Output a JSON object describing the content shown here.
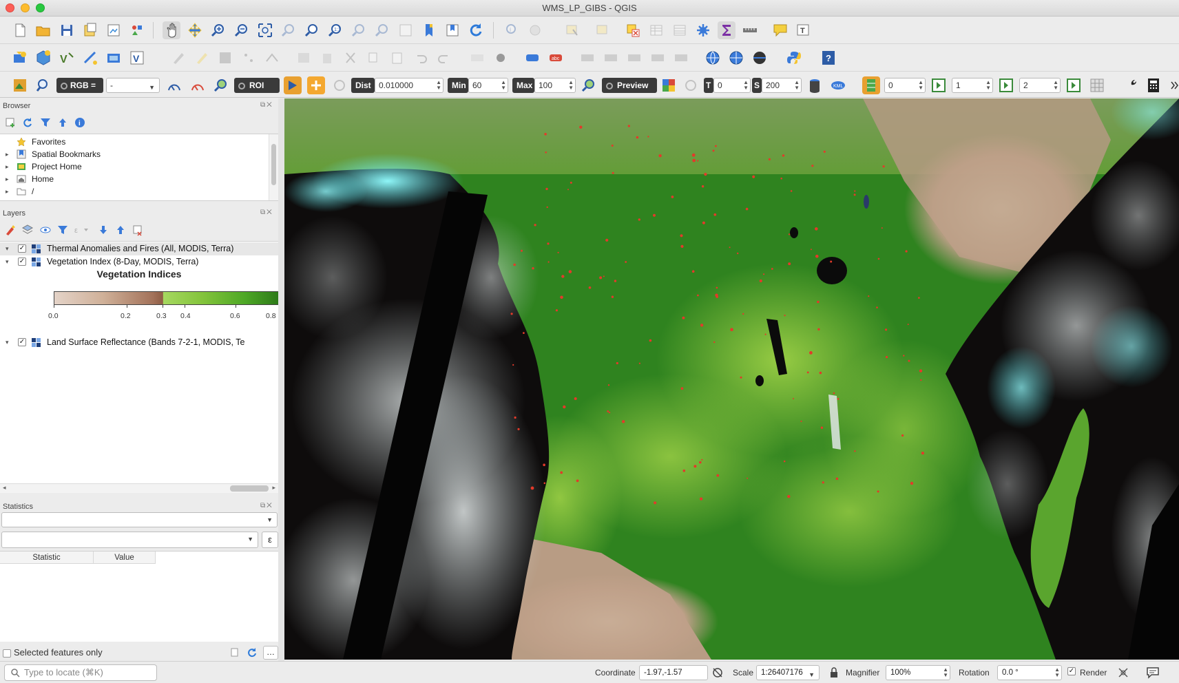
{
  "window": {
    "title": "WMS_LP_GIBS - QGIS"
  },
  "toolbar_raster": {
    "rgb_label": "RGB =",
    "band_combo": "-",
    "roi_label": "ROI",
    "dist_label": "Dist",
    "dist_value": "0.010000",
    "min_label": "Min",
    "min_value": "60",
    "max_label": "Max",
    "max_value": "100",
    "preview_label": "Preview",
    "t_label": "T",
    "t_value": "0",
    "s_label": "S",
    "s_value": "200",
    "spin_a": "0",
    "spin_b": "1",
    "spin_c": "2"
  },
  "browser": {
    "title": "Browser",
    "items": [
      {
        "label": "Favorites",
        "icon": "star-icon",
        "expandable": false
      },
      {
        "label": "Spatial Bookmarks",
        "icon": "bookmark-icon",
        "expandable": true
      },
      {
        "label": "Project Home",
        "icon": "project-home-icon",
        "expandable": true
      },
      {
        "label": "Home",
        "icon": "home-folder-icon",
        "expandable": true
      },
      {
        "label": "/",
        "icon": "folder-icon",
        "expandable": true
      }
    ]
  },
  "layers": {
    "title": "Layers",
    "items": [
      {
        "label": "Thermal Anomalies and Fires (All, MODIS, Terra)",
        "checked": true
      },
      {
        "label": "Vegetation Index (8-Day, MODIS, Terra)",
        "checked": true
      },
      {
        "label": "Land Surface Reflectance (Bands 7-2-1, MODIS, Te",
        "checked": true
      }
    ],
    "legend": {
      "title": "Vegetation Indices",
      "ticks": [
        "0.0",
        "0.2",
        "0.3",
        "0.4",
        "0.6",
        "0.8"
      ]
    }
  },
  "statistics": {
    "title": "Statistics",
    "sigma": "ε",
    "col_statistic": "Statistic",
    "col_value": "Value",
    "selected_only": "Selected features only"
  },
  "statusbar": {
    "locator_placeholder": "Type to locate (⌘K)",
    "coordinate_label": "Coordinate",
    "coordinate_value": "-1.97,-1.57",
    "scale_label": "Scale",
    "scale_value": "1:26407176",
    "magnifier_label": "Magnifier",
    "magnifier_value": "100%",
    "rotation_label": "Rotation",
    "rotation_value": "0.0 °",
    "render_label": "Render",
    "render_checked": true
  },
  "colors": {
    "vegetation_dark": "#2c7f1e",
    "vegetation_light": "#a8d84a",
    "fire_points": "#e33a2a",
    "clouds": "#7af3f5",
    "desert": "#b79b85"
  }
}
